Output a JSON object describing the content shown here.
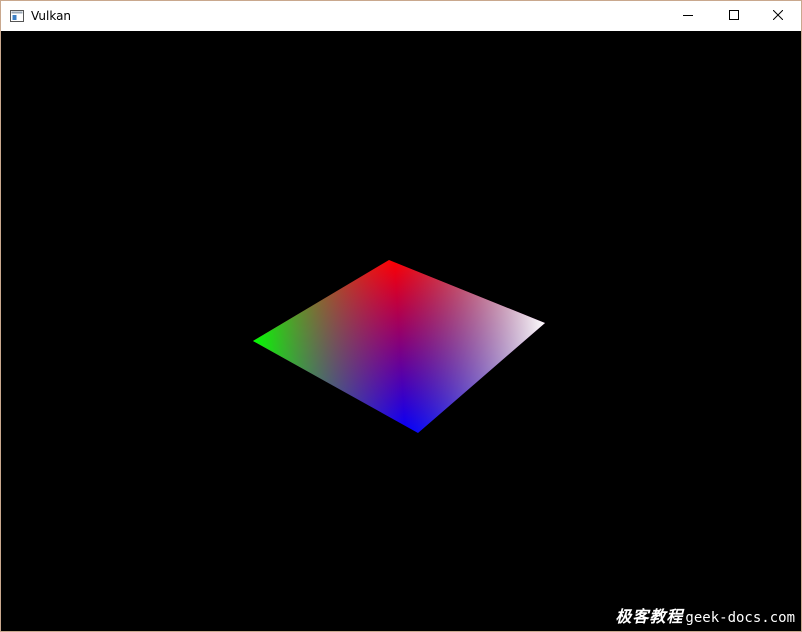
{
  "window": {
    "title": "Vulkan",
    "app_icon": "window-app-icon",
    "controls": {
      "minimize_icon": "minimize-icon",
      "maximize_icon": "maximize-icon",
      "close_icon": "close-icon"
    }
  },
  "scene": {
    "background": "#000000",
    "quad_vertex_colors": [
      "#ff0000",
      "#ffffff",
      "#0000ff",
      "#00ff00"
    ]
  },
  "watermark": {
    "cn_text": "极客教程",
    "en_text": "geek-docs.com"
  }
}
